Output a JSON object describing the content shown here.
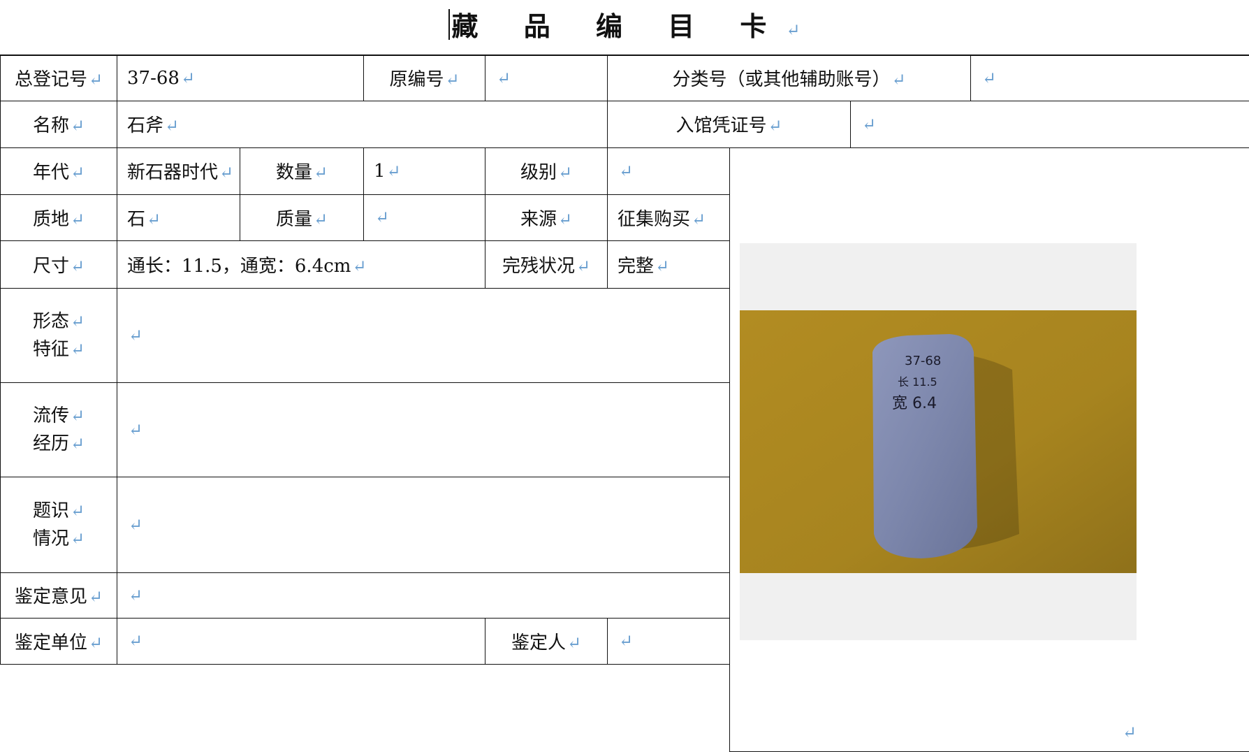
{
  "title": "藏 品 编 目 卡",
  "para_mark": "↵",
  "rows": {
    "reg_no_label": "总登记号",
    "reg_no_value": "37-68",
    "orig_no_label": "原编号",
    "orig_no_value": "",
    "class_no_label": "分类号（或其他辅助账号）",
    "class_no_value": "",
    "name_label": "名称",
    "name_value": "石斧",
    "voucher_label": "入馆凭证号",
    "voucher_value": "",
    "era_label": "年代",
    "era_value": "新石器时代",
    "qty_label": "数量",
    "qty_value": "1",
    "grade_label": "级别",
    "grade_value": "",
    "material_label": "质地",
    "material_value": "石",
    "mass_label": "质量",
    "mass_value": "",
    "source_label": "来源",
    "source_value": "征集购买",
    "size_label": "尺寸",
    "size_value": "通长：11.5，通宽：6.4cm",
    "condition_label": "完残状况",
    "condition_value": "完整",
    "morph_label_1": "形态",
    "morph_label_2": "特征",
    "morph_value": "",
    "history_label_1": "流传",
    "history_label_2": "经历",
    "history_value": "",
    "inscr_label_1": "题识",
    "inscr_label_2": "情况",
    "inscr_value": "",
    "opinion_label": "鉴定意见",
    "opinion_value": "",
    "unit_label": "鉴定单位",
    "unit_value": "",
    "appraiser_label": "鉴定人",
    "appraiser_value": ""
  },
  "photo": {
    "label_line1": "37-68",
    "label_line2": "长 11.5",
    "label_line3": "宽 6.4",
    "colors": {
      "background": "#a7841f",
      "stone": "#7d87ac",
      "frame": "#f0f0f0"
    }
  }
}
